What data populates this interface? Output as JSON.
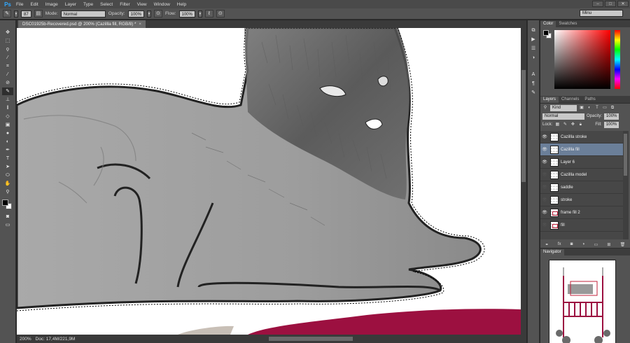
{
  "app": {
    "logo": "Ps",
    "menu": [
      "File",
      "Edit",
      "Image",
      "Layer",
      "Type",
      "Select",
      "Filter",
      "View",
      "Window",
      "Help"
    ]
  },
  "options": {
    "brush_size": "87",
    "mode_label": "Mode:",
    "mode_value": "Normal",
    "opacity_label": "Opacity:",
    "opacity_value": "100%",
    "flow_label": "Flow:",
    "flow_value": "100%",
    "workspace": "Minu"
  },
  "document": {
    "tab_title": "DSC01925b-Recovered.psd @ 200% (Cazillla fill, RGB/8) *",
    "zoom": "200%",
    "doc_info": "Doc: 17,4M/221,9M"
  },
  "color_panel": {
    "tabs": [
      "Color",
      "Swatches"
    ],
    "active_tab": "Color"
  },
  "layers_panel": {
    "tabs": [
      "Layers",
      "Channels",
      "Paths"
    ],
    "filter_value": "Kind",
    "blend_mode": "Normal",
    "opacity_label": "Opacity:",
    "opacity_value": "100%",
    "lock_label": "Lock:",
    "fill_label": "Fill:",
    "fill_value": "100%",
    "layers": [
      {
        "name": "Cazillla stroke",
        "visible": true,
        "selected": false
      },
      {
        "name": "Cazillla fill",
        "visible": true,
        "selected": true
      },
      {
        "name": "Layer 6",
        "visible": true,
        "selected": false
      },
      {
        "name": "Cazillla model",
        "visible": false,
        "selected": false
      },
      {
        "name": "saddle",
        "visible": false,
        "selected": false
      },
      {
        "name": "stroke",
        "visible": false,
        "selected": false
      },
      {
        "name": "frame fill 2",
        "visible": true,
        "selected": false
      },
      {
        "name": "fill",
        "visible": false,
        "selected": false
      }
    ]
  },
  "navigator": {
    "title": "Navigator"
  }
}
